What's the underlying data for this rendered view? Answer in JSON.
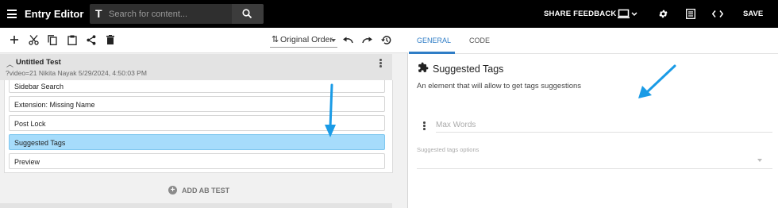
{
  "header": {
    "title": "Entry Editor",
    "search_placeholder": "Search for content...",
    "share_feedback": "SHARE FEEDBACK",
    "save": "SAVE",
    "icons": [
      "menu-icon",
      "search-icon",
      "laptop-icon",
      "settings-icon",
      "list-icon",
      "code-icon"
    ]
  },
  "toolbar": {
    "icons": [
      "add-icon",
      "cut-icon",
      "copy-icon",
      "paste-icon",
      "share-icon",
      "delete-icon",
      "undo-icon",
      "redo-icon",
      "history-icon"
    ],
    "order_label": "Original Order"
  },
  "test": {
    "name": "Untitled Test",
    "meta": "?video=21 Nikita Nayak 5/29/2024, 4:50:03 PM"
  },
  "entries": [
    {
      "label": "Sidebar Search"
    },
    {
      "label": "Extension: Missing Name"
    },
    {
      "label": "Post Lock"
    },
    {
      "label": "Suggested Tags",
      "selected": true
    },
    {
      "label": "Preview"
    }
  ],
  "add_ab_test": "ADD AB TEST",
  "panel": {
    "tabs": [
      {
        "label": "GENERAL",
        "active": true
      },
      {
        "label": "CODE",
        "active": false
      }
    ],
    "title": "Suggested Tags",
    "description": "An element that will allow to get tags suggestions",
    "max_words_placeholder": "Max Words",
    "options_label": "Suggested tags options"
  },
  "colors": {
    "topbar": "#000000",
    "accent": "#2f7dc6",
    "selected_entry": "#a6dcfb",
    "annotation_arrow": "#1a9be6"
  }
}
